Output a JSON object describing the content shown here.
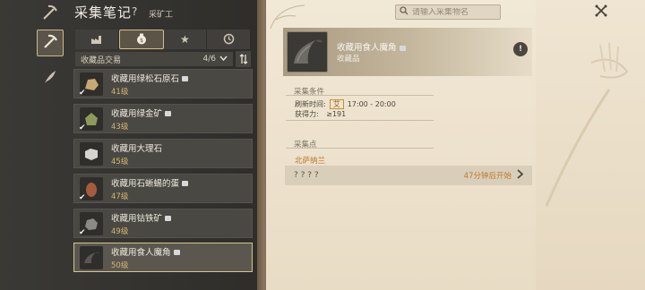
{
  "header": {
    "title": "采集笔记",
    "help": "?",
    "subtitle": "采矿工"
  },
  "tabs": [
    {
      "icon": "factory-icon",
      "active": false
    },
    {
      "icon": "money-bag-icon",
      "active": true
    },
    {
      "icon": "star-icon",
      "active": false
    },
    {
      "icon": "clock-icon",
      "active": false
    }
  ],
  "filter": {
    "label": "收藏品交易",
    "count": "4/6"
  },
  "list": [
    {
      "name": "收藏用绿松石原石",
      "level": "41级",
      "checked": true,
      "color": "#c7a874"
    },
    {
      "name": "收藏用绿金矿",
      "level": "43级",
      "checked": true,
      "color": "#8e9a5c"
    },
    {
      "name": "收藏用大理石",
      "level": "45级",
      "checked": false,
      "color": "#d6d4cf"
    },
    {
      "name": "收藏用石蜥蜴的蛋",
      "level": "47级",
      "checked": true,
      "color": "#a65a3e"
    },
    {
      "name": "收藏用钴铁矿",
      "level": "49级",
      "checked": true,
      "color": "#8c8a86"
    },
    {
      "name": "收藏用食人魔角",
      "level": "50级",
      "checked": false,
      "color": "#5a5854",
      "selected": true
    }
  ],
  "search": {
    "placeholder": "请输入采集物名"
  },
  "detail": {
    "name": "收藏用食人魔角",
    "type": "收藏品",
    "info": "!",
    "section_conditions": "采集条件",
    "refresh_label": "刷新时间:",
    "refresh_tag": "艾",
    "refresh_time": "17:00 - 20:00",
    "power_label": "获得力:",
    "power_value": "≥191",
    "section_points": "采集点",
    "location": "北萨纳兰",
    "point_name": "? ? ? ?",
    "timer": "47分钟后开始"
  }
}
